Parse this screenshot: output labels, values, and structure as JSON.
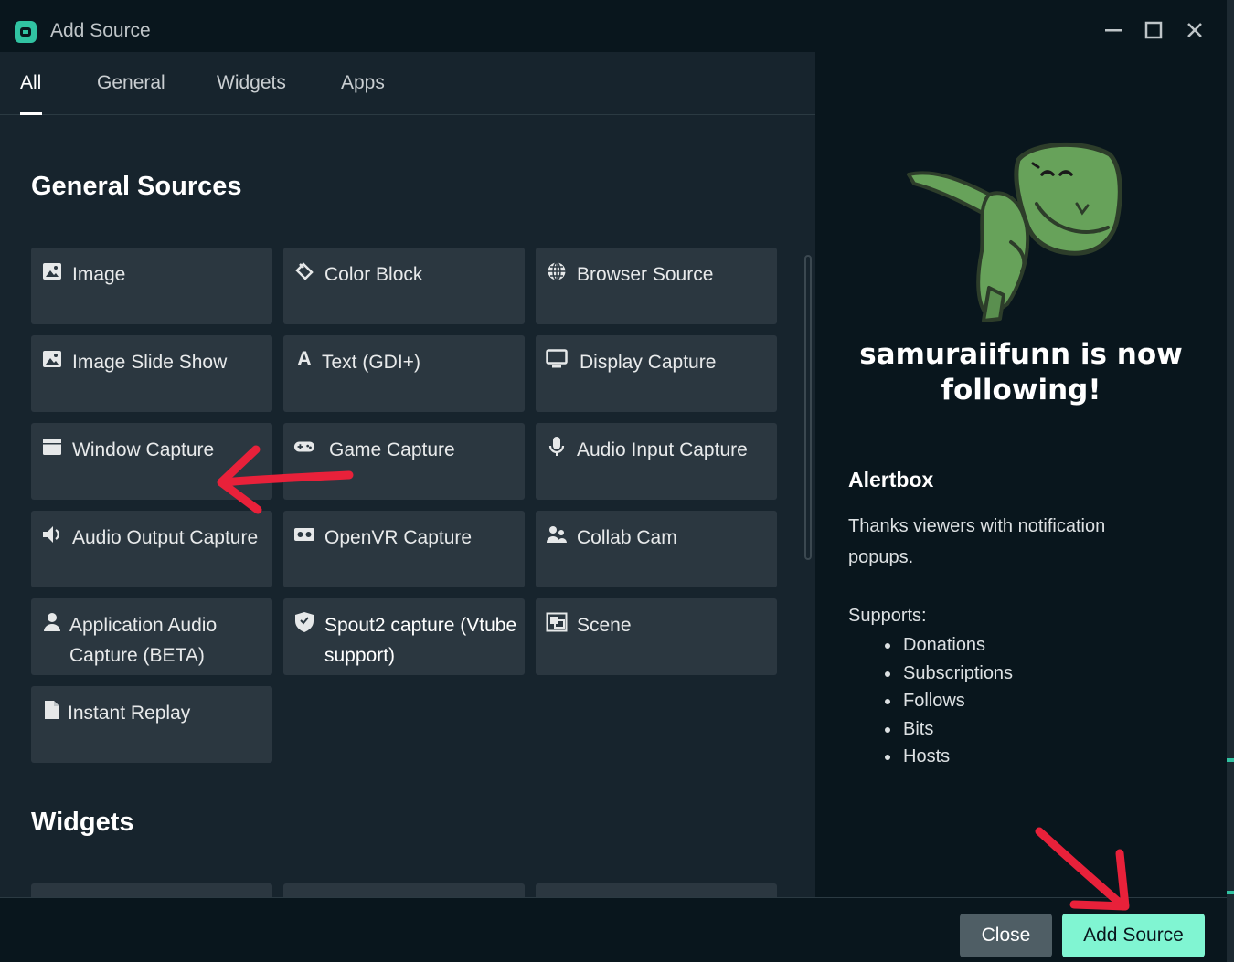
{
  "window": {
    "title": "Add Source",
    "controls": {
      "minimize": "—",
      "maximize": "☐",
      "close": "✕"
    }
  },
  "tabs": [
    {
      "label": "All",
      "active": true
    },
    {
      "label": "General",
      "active": false
    },
    {
      "label": "Widgets",
      "active": false
    },
    {
      "label": "Apps",
      "active": false
    }
  ],
  "sections": {
    "general_title": "General Sources",
    "widgets_title": "Widgets"
  },
  "sources": [
    {
      "label": "Image",
      "icon": "image-icon"
    },
    {
      "label": "Color Block",
      "icon": "paint-bucket-icon"
    },
    {
      "label": "Browser Source",
      "icon": "globe-icon"
    },
    {
      "label": "Image Slide Show",
      "icon": "image-icon"
    },
    {
      "label": "Text (GDI+)",
      "icon": "text-icon"
    },
    {
      "label": "Display Capture",
      "icon": "monitor-icon"
    },
    {
      "label": "Window Capture",
      "icon": "window-icon"
    },
    {
      "label": "Game Capture",
      "icon": "gamepad-icon"
    },
    {
      "label": "Audio Input Capture",
      "icon": "microphone-icon"
    },
    {
      "label": "Audio Output Capture",
      "icon": "speaker-icon"
    },
    {
      "label": "OpenVR Capture",
      "icon": "vr-headset-icon"
    },
    {
      "label": "Collab Cam",
      "icon": "users-icon"
    },
    {
      "label": "Application Audio Capture (BETA)",
      "icon": "user-icon"
    },
    {
      "label": "Spout2 capture (Vtube support)",
      "icon": "shield-icon"
    },
    {
      "label": "Scene",
      "icon": "scene-icon"
    },
    {
      "label": "Instant Replay",
      "icon": "file-icon"
    }
  ],
  "preview": {
    "alert_text": "samuraiifunn is now following!",
    "widget_name": "Alertbox",
    "description": "Thanks viewers with notification popups.",
    "supports_label": "Supports:",
    "supports": [
      "Donations",
      "Subscriptions",
      "Follows",
      "Bits",
      "Hosts"
    ]
  },
  "footer": {
    "close_label": "Close",
    "add_label": "Add Source"
  },
  "colors": {
    "accent": "#80f5d2",
    "background": "#09161d",
    "panel": "#17242d",
    "card": "#2b3740",
    "annotation_arrow": "#e8213a"
  }
}
